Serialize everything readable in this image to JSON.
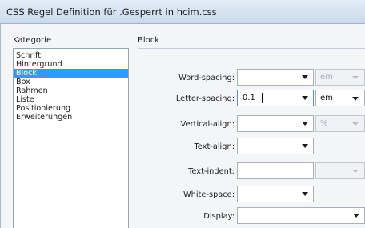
{
  "window": {
    "title": "CSS Regel Definition für .Gesperrt in hcim.css"
  },
  "categories": {
    "label": "Kategorie",
    "items": [
      {
        "label": "Schrift"
      },
      {
        "label": "Hintergrund"
      },
      {
        "label": "Block",
        "selected": true
      },
      {
        "label": "Box"
      },
      {
        "label": "Rahmen"
      },
      {
        "label": "Liste"
      },
      {
        "label": "Positionierung"
      },
      {
        "label": "Erweiterungen"
      }
    ]
  },
  "panel": {
    "title": "Block",
    "fields": {
      "word_spacing": {
        "label": "Word-spacing:",
        "value": "",
        "unit": "em",
        "unit_enabled": false
      },
      "letter_spacing": {
        "label": "Letter-spacing:",
        "value": "0.1",
        "unit": "em",
        "unit_enabled": true
      },
      "vertical_align": {
        "label": "Vertical-align:",
        "value": "",
        "unit": "%",
        "unit_enabled": false
      },
      "text_align": {
        "label": "Text-align:",
        "value": ""
      },
      "text_indent": {
        "label": "Text-indent:",
        "value": "",
        "unit": "",
        "unit_enabled": false
      },
      "white_space": {
        "label": "White-space:",
        "value": ""
      },
      "display": {
        "label": "Display:",
        "value": ""
      }
    }
  }
}
